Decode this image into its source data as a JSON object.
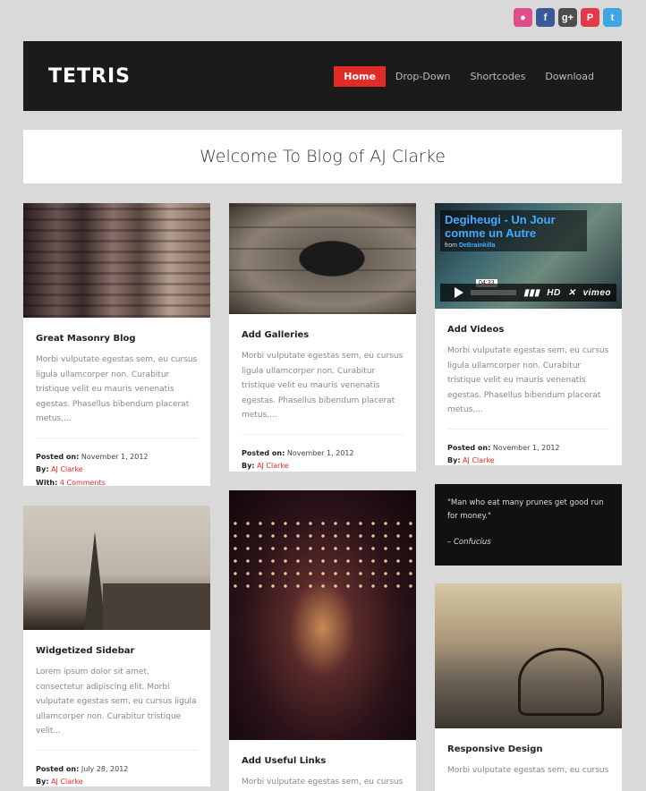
{
  "social": [
    "dribbble",
    "facebook",
    "google-plus",
    "pinterest",
    "twitter"
  ],
  "header": {
    "logo": "TETRIS",
    "nav": [
      {
        "label": "Home",
        "active": true
      },
      {
        "label": "Drop-Down"
      },
      {
        "label": "Shortcodes"
      },
      {
        "label": "Download"
      }
    ]
  },
  "welcome": "Welcome To Blog of AJ Clarke",
  "posts": {
    "masonry": {
      "title": "Great Masonry Blog",
      "excerpt": "Morbi vulputate egestas sem, eu cursus ligula ullamcorper non. Curabitur tristique velit eu mauris venenatis egestas. Phasellus bibendum placerat metus,...",
      "posted_label": "Posted on:",
      "date": "November 1, 2012",
      "by_label": "By:",
      "author": "AJ Clarke",
      "with_label": "With:",
      "comments": "4 Comments"
    },
    "galleries": {
      "title": "Add Galleries",
      "excerpt": "Morbi vulputate egestas sem, eu cursus ligula ullamcorper non. Curabitur tristique velit eu mauris venenatis egestas. Phasellus bibendum placerat metus,...",
      "posted_label": "Posted on:",
      "date": "November 1, 2012",
      "by_label": "By:",
      "author": "AJ Clarke"
    },
    "videos": {
      "video_title": "Degiheugi - Un Jour comme un Autre",
      "video_from": "from",
      "video_author": "DeBrainkilla",
      "video_time": "04:33",
      "video_hd": "HD",
      "video_brand": "vimeo",
      "title": "Add Videos",
      "excerpt": "Morbi vulputate egestas sem, eu cursus ligula ullamcorper non. Curabitur tristique velit eu mauris venenatis egestas. Phasellus bibendum placerat metus,...",
      "posted_label": "Posted on:",
      "date": "November 1, 2012",
      "by_label": "By:",
      "author": "AJ Clarke"
    },
    "quote": {
      "text": "\"Man who eat many prunes get good run for money.\"",
      "author": "– Confucius"
    },
    "sidebar": {
      "title": "Widgetized Sidebar",
      "excerpt": "Lorem ipsum dolor sit amet, consectetur adipiscing elit. Morbi vulputate egestas sem, eu cursus ligula ullamcorper non. Curabitur tristique velit...",
      "posted_label": "Posted on:",
      "date": "July 28, 2012",
      "by_label": "By:",
      "author": "AJ Clarke"
    },
    "links": {
      "title": "Add Useful Links",
      "excerpt": "Morbi vulputate egestas sem, eu cursus"
    },
    "responsive": {
      "title": "Responsive Design",
      "excerpt": "Morbi vulputate egestas sem, eu cursus"
    }
  }
}
